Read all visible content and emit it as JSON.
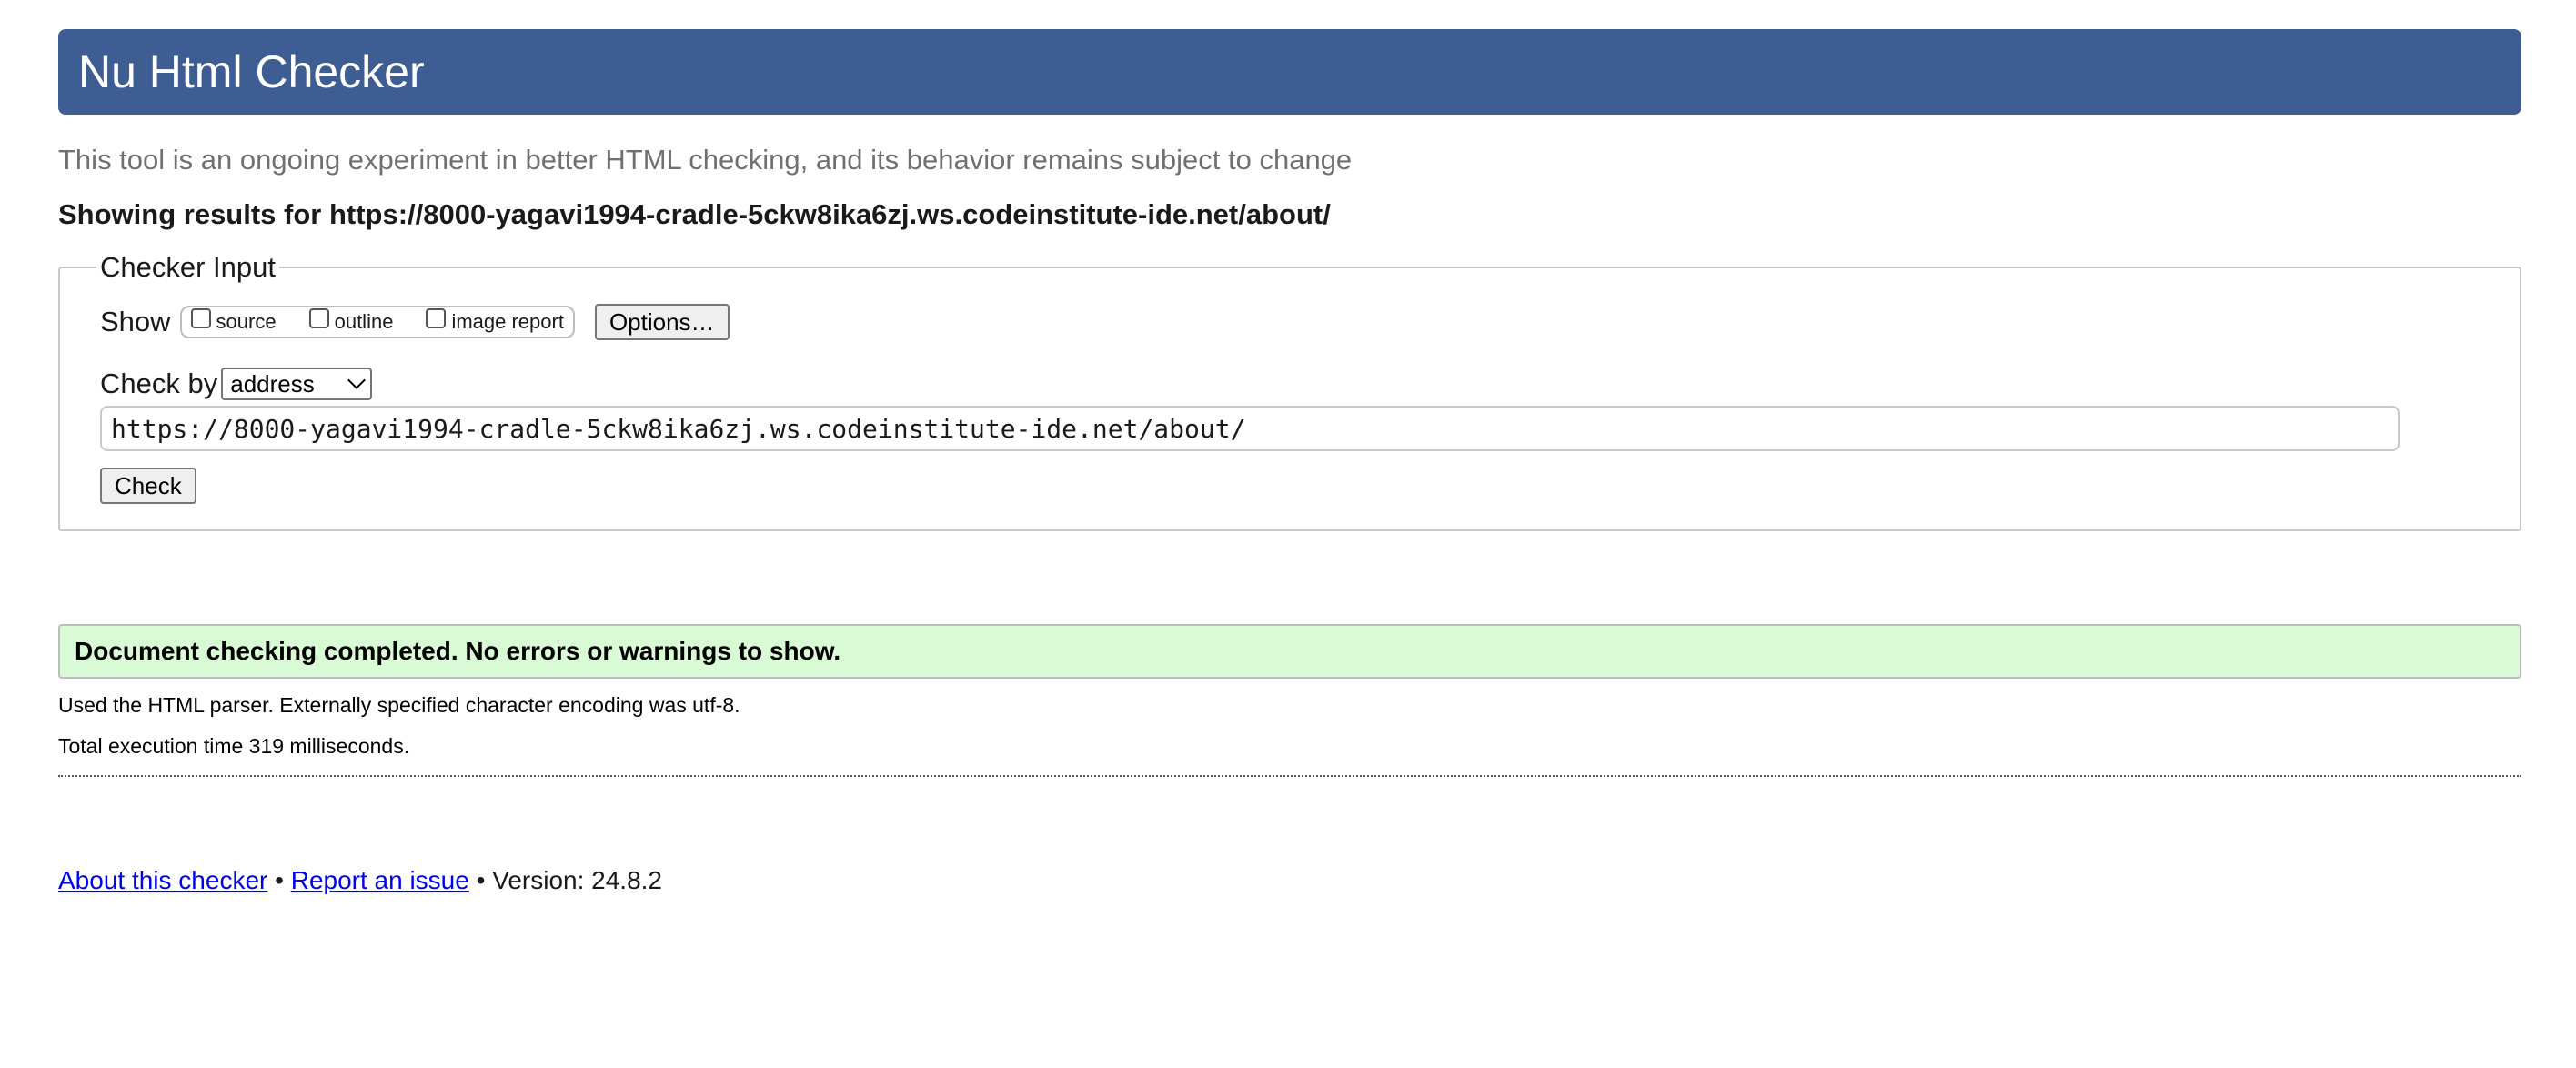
{
  "banner": {
    "title": "Nu Html Checker"
  },
  "subtitle": "This tool is an ongoing experiment in better HTML checking, and its behavior remains subject to change",
  "results_heading": "Showing results for https://8000-yagavi1994-cradle-5ckw8ika6zj.ws.codeinstitute-ide.net/about/",
  "checker_input": {
    "legend": "Checker Input",
    "show_label": "Show",
    "options": [
      {
        "label": "source",
        "checked": false
      },
      {
        "label": "outline",
        "checked": false
      },
      {
        "label": "image report",
        "checked": false
      }
    ],
    "options_button": "Options…",
    "check_by_label": "Check by",
    "check_by_selected": "address",
    "url_value": "https://8000-yagavi1994-cradle-5ckw8ika6zj.ws.codeinstitute-ide.net/about/",
    "check_button": "Check"
  },
  "result": {
    "status": "Document checking completed. No errors or warnings to show.",
    "status_color": "#d8fad5",
    "parser_info": "Used the HTML parser. Externally specified character encoding was utf-8.",
    "execution_time": "Total execution time 319 milliseconds."
  },
  "footer": {
    "about_link": "About this checker",
    "separator1": " • ",
    "report_link": "Report an issue",
    "version": " • Version: 24.8.2"
  },
  "colors": {
    "banner": "#3e5e93",
    "link": "#0000ee"
  }
}
